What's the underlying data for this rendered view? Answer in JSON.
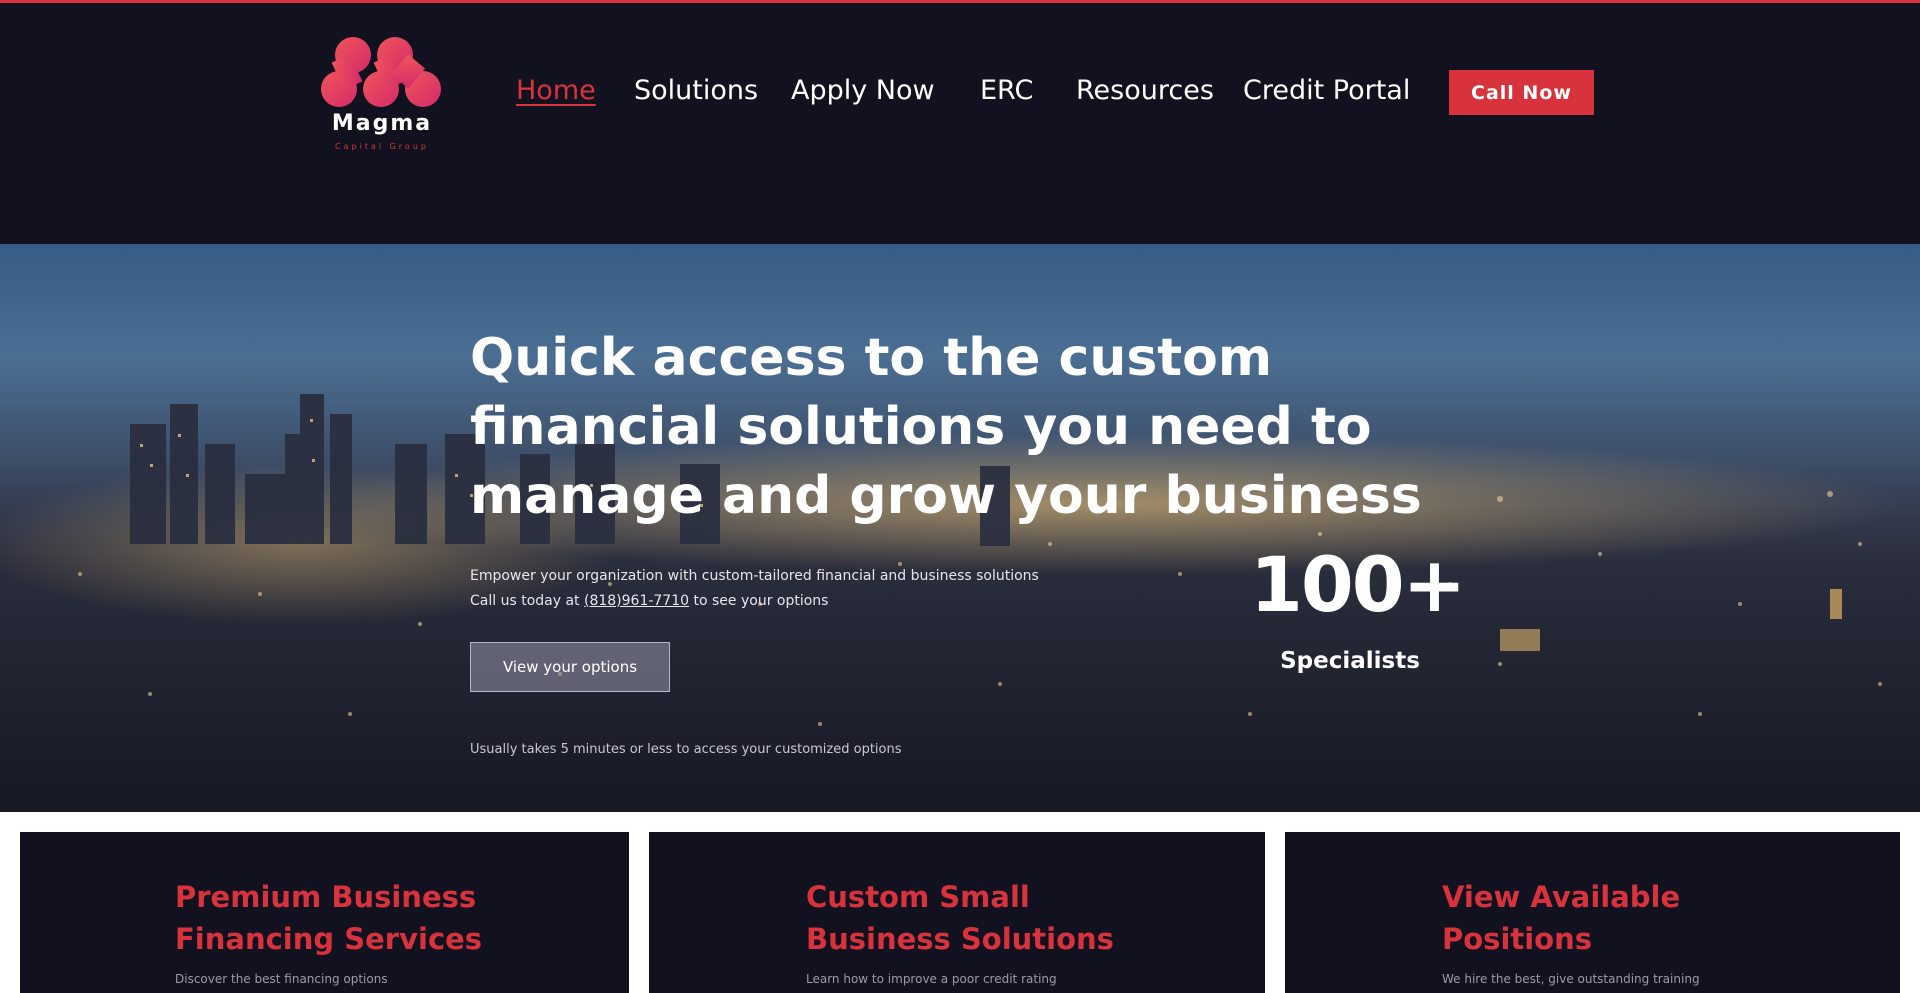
{
  "brand": {
    "name": "Magma",
    "tagline": "Capital Group",
    "accent_color": "#d8333c",
    "header_bg": "#12111f"
  },
  "nav": {
    "items": [
      {
        "label": "Home",
        "active": true
      },
      {
        "label": "Solutions",
        "active": false
      },
      {
        "label": "Apply Now",
        "active": false
      },
      {
        "label": "ERC",
        "active": false
      },
      {
        "label": "Resources",
        "active": false
      },
      {
        "label": "Credit Portal",
        "active": false
      }
    ],
    "cta_label": "Call Now"
  },
  "hero": {
    "title": "Quick access to the custom financial solutions you need to manage and grow your business",
    "subtitle_line1": "Empower your organization with custom-tailored financial and business solutions",
    "subtitle_line2_prefix": "Call us today at ",
    "phone": "(818)961-7710",
    "subtitle_line2_suffix": " to see your options",
    "button_label": "View your options",
    "note": "Usually takes 5 minutes or less to access your customized options",
    "stat_value": "100+",
    "stat_label": "Specialists"
  },
  "cards": [
    {
      "title_line1": "Premium Business",
      "title_line2": "Financing Services",
      "description": "Discover the best financing options"
    },
    {
      "title_line1": "Custom Small",
      "title_line2": "Business Solutions",
      "description": "Learn how to improve a poor credit rating"
    },
    {
      "title_line1": "View Available",
      "title_line2": "Positions",
      "description": "We hire the best, give outstanding training"
    }
  ]
}
